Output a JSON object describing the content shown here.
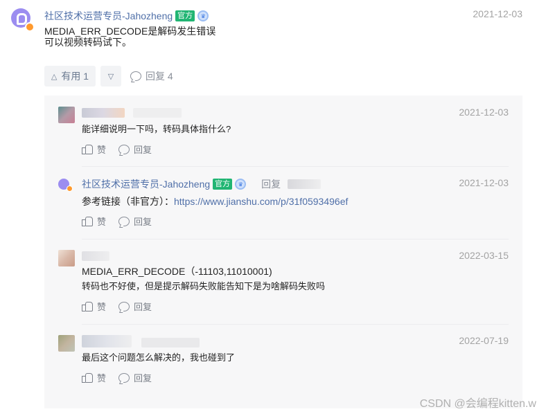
{
  "comment": {
    "author": "社区技术运营专员-Jahozheng",
    "badge_official": "官方",
    "date": "2021-12-03",
    "lines": [
      "MEDIA_ERR_DECODE是解码发生错误",
      "可以视频转码试下。"
    ],
    "useful_label": "有用 1",
    "reply_label": "回复 4"
  },
  "replies": [
    {
      "date": "2021-12-03",
      "text": "能详细说明一下吗，转码具体指什么?",
      "like_label": "赞",
      "reply_label": "回复"
    },
    {
      "author": "社区技术运营专员-Jahozheng",
      "badge_official": "官方",
      "reply_to_label": "回复",
      "date": "2021-12-03",
      "text_prefix": "参考链接（非官方）：",
      "link": "https://www.jianshu.com/p/31f0593496ef",
      "like_label": "赞",
      "reply_label": "回复"
    },
    {
      "date": "2022-03-15",
      "text_line1": "MEDIA_ERR_DECODE（-11103,11010001)",
      "text_line2": "转码也不好使，但是提示解码失败能告知下是为啥解码失败吗",
      "like_label": "赞",
      "reply_label": "回复"
    },
    {
      "date": "2022-07-19",
      "text": "最后这个问题怎么解决的，我也碰到了",
      "like_label": "赞",
      "reply_label": "回复"
    }
  ],
  "watermark": "CSDN @会编程kitten.w",
  "colors": {
    "author": "#4f6fa8",
    "official_badge": "#21b573",
    "date": "#a3a3a3",
    "reply_panel_bg": "#f7f7f8"
  }
}
